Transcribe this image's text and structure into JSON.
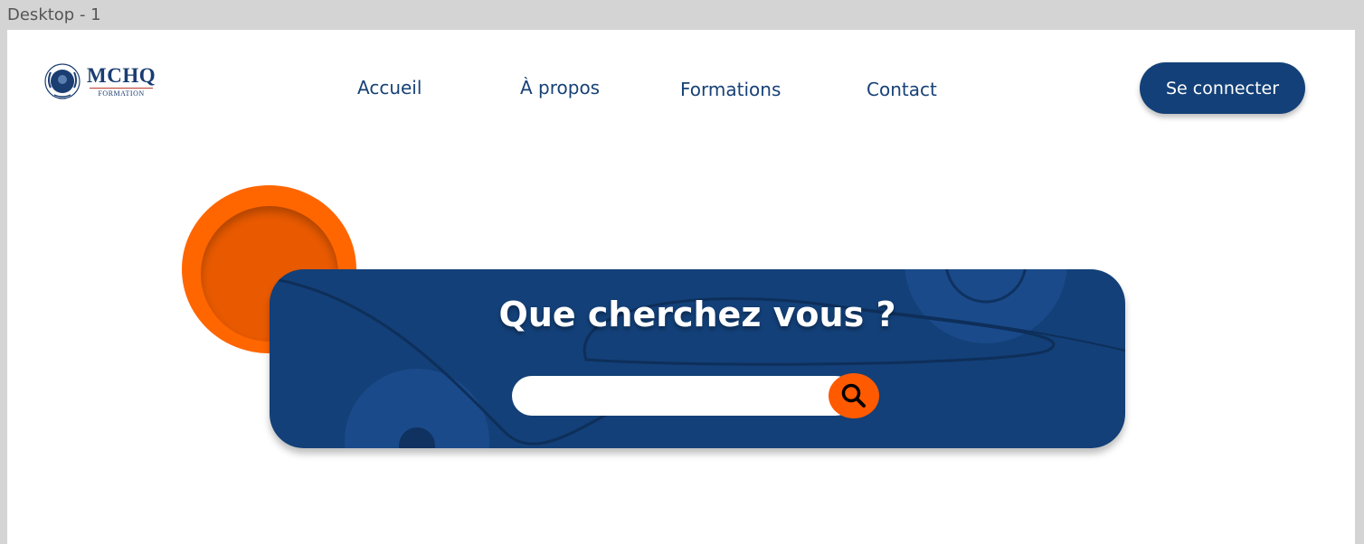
{
  "frame": {
    "label": "Desktop - 1"
  },
  "brand": {
    "name": "MCHQ",
    "subtitle": "FORMATION",
    "logo_icon": "laurel-seal-icon"
  },
  "nav": {
    "items": [
      {
        "label": "Accueil"
      },
      {
        "label": "À propos"
      },
      {
        "label": "Formations"
      },
      {
        "label": "Contact"
      }
    ],
    "login_label": "Se connecter"
  },
  "hero": {
    "title": "Que cherchez vous ?",
    "search_placeholder": "",
    "search_icon": "magnifier-icon"
  },
  "colors": {
    "primary": "#134078",
    "accent": "#ff6600",
    "background": "#ffffff"
  }
}
